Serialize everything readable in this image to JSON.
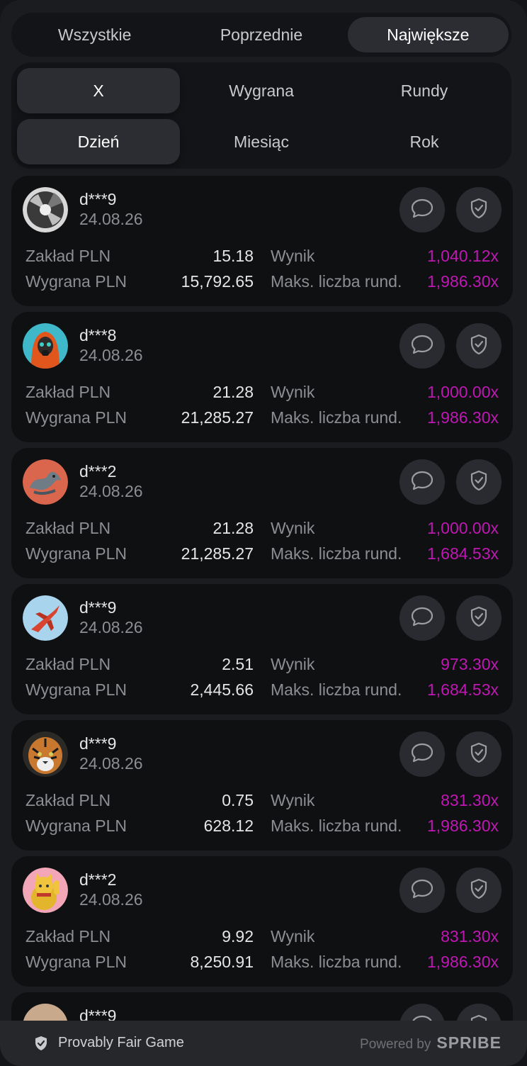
{
  "tabs": [
    "Wszystkie",
    "Poprzednie",
    "Największe"
  ],
  "active_tab": 2,
  "filters_row1": [
    "X",
    "Wygrana",
    "Rundy"
  ],
  "filters_row2": [
    "Dzień",
    "Miesiąc",
    "Rok"
  ],
  "labels": {
    "bet": "Zakład PLN",
    "win": "Wygrana PLN",
    "result": "Wynik",
    "max_rounds": "Maks. liczba rund."
  },
  "cards": [
    {
      "user": "d***9",
      "date": "24.08.26",
      "bet": "15.18",
      "win": "15,792.65",
      "result": "1,040.12x",
      "max": "1,986.30x",
      "avatar": "propeller-avatar"
    },
    {
      "user": "d***8",
      "date": "24.08.26",
      "bet": "21.28",
      "win": "21,285.27",
      "result": "1,000.00x",
      "max": "1,986.30x",
      "avatar": "gasmask-avatar"
    },
    {
      "user": "d***2",
      "date": "24.08.26",
      "bet": "21.28",
      "win": "21,285.27",
      "result": "1,000.00x",
      "max": "1,684.53x",
      "avatar": "dragon-avatar"
    },
    {
      "user": "d***9",
      "date": "24.08.26",
      "bet": "2.51",
      "win": "2,445.66",
      "result": "973.30x",
      "max": "1,684.53x",
      "avatar": "jet-avatar"
    },
    {
      "user": "d***9",
      "date": "24.08.26",
      "bet": "0.75",
      "win": "628.12",
      "result": "831.30x",
      "max": "1,986.30x",
      "avatar": "tiger-avatar"
    },
    {
      "user": "d***2",
      "date": "24.08.26",
      "bet": "9.92",
      "win": "8,250.91",
      "result": "831.30x",
      "max": "1,986.30x",
      "avatar": "lucky-cat-avatar"
    }
  ],
  "partial_card": {
    "user": "d***9"
  },
  "footer": {
    "provably": "Provably Fair Game",
    "powered_by": "Powered by",
    "brand": "SPRIBE"
  },
  "colors": {
    "multiplier": "#c017b4",
    "background": "#1b1c1f"
  }
}
